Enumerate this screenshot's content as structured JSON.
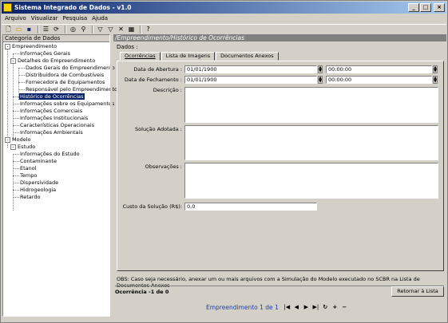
{
  "window": {
    "title": "Sistema Integrado de Dados - v1.0"
  },
  "menu": [
    "Arquivo",
    "Visualizar",
    "Pesquisa",
    "Ajuda"
  ],
  "toolbar_icons": [
    "new-file-icon",
    "open-icon",
    "save-icon",
    "list-icon",
    "refresh-icon",
    "binoculars-icon",
    "search-icon",
    "filter-icon",
    "filter-add-icon",
    "filter-clear-icon",
    "data-icon",
    "help-icon"
  ],
  "left_panel": {
    "header": "Categoria de Dados",
    "tree": [
      "Empreendimento",
      "Informações Gerais",
      "Detalhes do Empreendimento",
      "Dados Gerais do Empreendimento",
      "Distribuidora de Combustíveis",
      "Fornecedora de Equipamentos",
      "Responsável pelo Empreendimento",
      "Histórico de Ocorrências",
      "Informações sobre os Equipamentos",
      "Informações Comerciais",
      "Informações Institucionais",
      "Características Operacionais",
      "Informações Ambientais",
      "Modelo",
      "Estudo",
      "Informações do Estudo",
      "Contaminante",
      "Etanol",
      "Tempo",
      "Dispersividade",
      "Hidrogeologia",
      "Retardo"
    ]
  },
  "main": {
    "title": "/Empreendimento/Histórico de Ocorrências",
    "group_label": "Dados :",
    "tabs": [
      "Ocorrências",
      "Lista de Imagens",
      "Documentos Anexos"
    ],
    "fields": {
      "data_abertura_label": "Data de Abertura :",
      "data_abertura_date": "01/01/1900",
      "data_abertura_time": "00:00:00",
      "data_fechamento_label": "Data de Fechamento :",
      "data_fechamento_date": "01/01/1900",
      "data_fechamento_time": "00:00:00",
      "descricao_label": "Descrição :",
      "solucao_label": "Solução Adotada :",
      "observacoes_label": "Observações :",
      "custo_label": "Custo da Solução (R$):",
      "custo_value": "0,0"
    },
    "obs_note": "OBS: Caso seja necessário, anexar um ou mais arquivos com a Simulação do Modelo executado no SCBR na Lista de Documentos Anexos",
    "record_count": "Ocorrência -1 de 0",
    "return_button": "Retornar à Lista",
    "navigator_text": "Empreendimento 1 de 1"
  }
}
